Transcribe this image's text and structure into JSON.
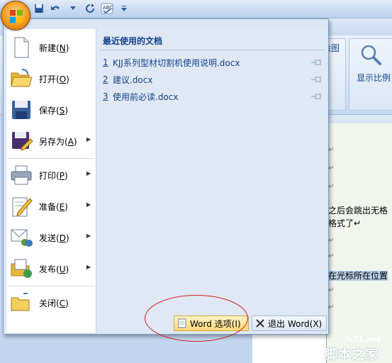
{
  "window": {
    "quick_access": [
      {
        "icon": "save-icon",
        "glyph": "▪"
      },
      {
        "icon": "undo-icon",
        "glyph": "↶"
      },
      {
        "icon": "dropdown-icon",
        "glyph": "▾"
      },
      {
        "icon": "redo-icon",
        "glyph": "↻"
      },
      {
        "icon": "spelling-icon",
        "glyph": "✓"
      },
      {
        "icon": "customize-icon",
        "glyph": "▾"
      }
    ],
    "ribbon": {
      "partial_label": "绘图",
      "zoom_label": "显示比例"
    }
  },
  "office_menu": {
    "left_items": [
      {
        "label": "新建",
        "key": "N",
        "icon": "new-document-icon",
        "has_submenu": false
      },
      {
        "label": "打开",
        "key": "O",
        "icon": "open-folder-icon",
        "has_submenu": false
      },
      {
        "label": "保存",
        "key": "S",
        "icon": "save-disk-icon",
        "has_submenu": false
      },
      {
        "label": "另存为",
        "key": "A",
        "icon": "save-as-icon",
        "has_submenu": true
      },
      {
        "label": "打印",
        "key": "P",
        "icon": "printer-icon",
        "has_submenu": true
      },
      {
        "label": "准备",
        "key": "E",
        "icon": "prepare-icon",
        "has_submenu": true
      },
      {
        "label": "发送",
        "key": "D",
        "icon": "send-icon",
        "has_submenu": true
      },
      {
        "label": "发布",
        "key": "U",
        "icon": "publish-icon",
        "has_submenu": true
      },
      {
        "label": "关闭",
        "key": "C",
        "icon": "close-folder-icon",
        "has_submenu": false
      }
    ],
    "recent_title": "最近使用的文档",
    "recent_documents": [
      {
        "number": "1",
        "name": "KJJ系列型材切割机使用说明.docx"
      },
      {
        "number": "2",
        "name": "建议.docx"
      },
      {
        "number": "3",
        "name": "使用前必读.docx"
      }
    ],
    "footer": {
      "options_label": "Word 选项(I)",
      "exit_label": "退出 Word(X)"
    }
  },
  "document": {
    "lines": [
      {
        "text": "之后会跳出无格"
      },
      {
        "text": "格式了↵"
      },
      {
        "text": "在光标所在位置"
      }
    ]
  },
  "watermark": {
    "site": "jb51.net",
    "name": "脚本之家"
  },
  "colors": {
    "accent": "#15428b",
    "annotation_circle": "#d0231c",
    "office_button": "#f59b1c"
  }
}
